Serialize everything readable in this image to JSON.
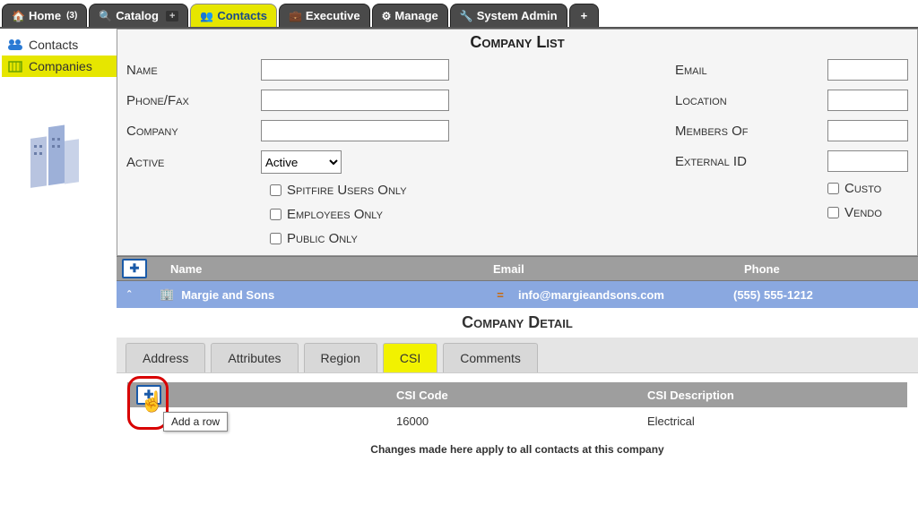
{
  "topTabs": {
    "home": "Home",
    "homeBadge": "(3)",
    "catalog": "Catalog",
    "contacts": "Contacts",
    "executive": "Executive",
    "manage": "Manage",
    "systemAdmin": "System Admin"
  },
  "sidebar": {
    "contacts": "Contacts",
    "companies": "Companies"
  },
  "companyList": {
    "title": "Company List",
    "labels": {
      "name": "Name",
      "phoneFax": "Phone/Fax",
      "company": "Company",
      "active": "Active",
      "email": "Email",
      "location": "Location",
      "membersOf": "Members Of",
      "externalId": "External ID"
    },
    "activeOptions": [
      "Active"
    ],
    "activeValue": "Active",
    "checks": {
      "spitfire": "Spitfire Users Only",
      "employees": "Employees Only",
      "public": "Public Only",
      "custo": "Custo",
      "vendo": "Vendo"
    },
    "columns": {
      "name": "Name",
      "email": "Email",
      "phone": "Phone"
    },
    "rows": [
      {
        "name": "Margie and Sons",
        "email": "info@margieandsons.com",
        "phone": "(555) 555-1212"
      }
    ]
  },
  "companyDetail": {
    "title": "Company Detail",
    "tabs": {
      "address": "Address",
      "attributes": "Attributes",
      "region": "Region",
      "csi": "CSI",
      "comments": "Comments"
    },
    "csi": {
      "columns": {
        "code": "CSI Code",
        "desc": "CSI Description"
      },
      "addTooltip": "Add a row",
      "rows": [
        {
          "code": "16000",
          "desc": "Electrical"
        }
      ]
    },
    "note": "Changes made here apply to all contacts at this company"
  }
}
